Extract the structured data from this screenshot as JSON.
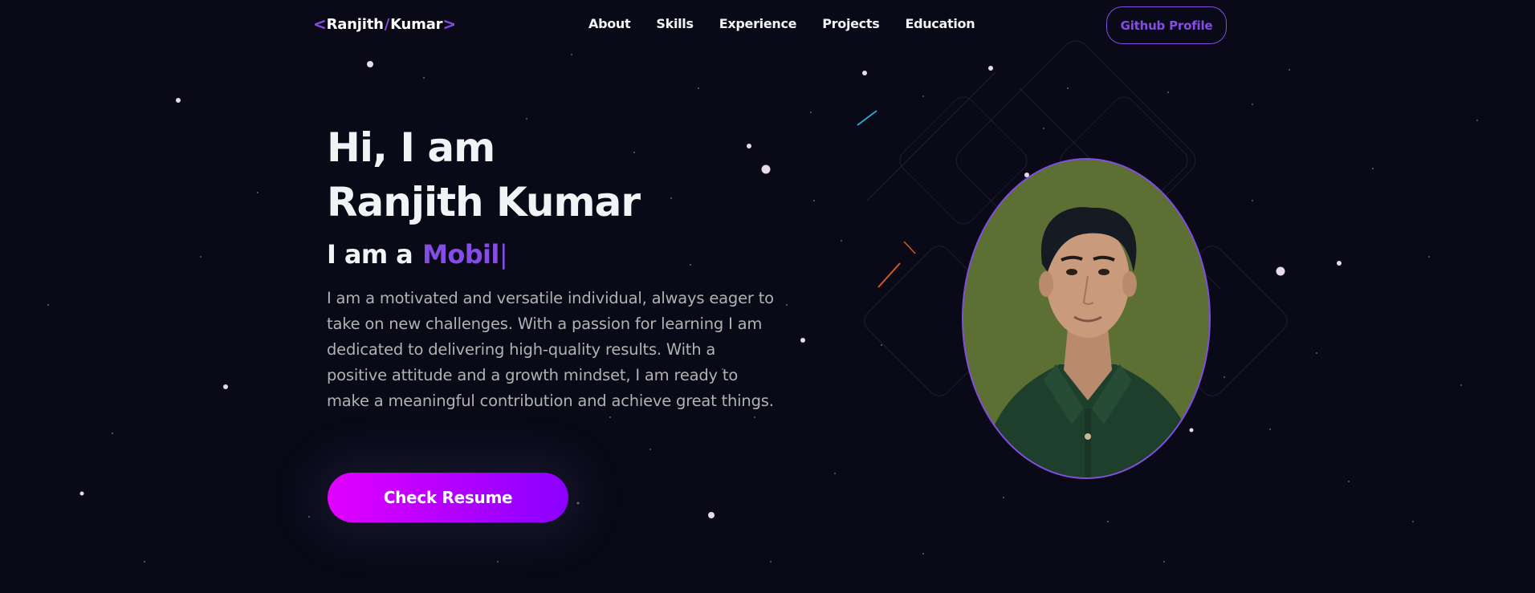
{
  "nav": {
    "logo": {
      "left_bracket": "<",
      "first": "Ranjith",
      "slash": "/",
      "last": "Kumar",
      "right_bracket": ">"
    },
    "links": [
      "About",
      "Skills",
      "Experience",
      "Projects",
      "Education"
    ],
    "github_label": "Github Profile"
  },
  "hero": {
    "title_line1": "Hi, I am",
    "title_line2": "Ranjith Kumar",
    "role_prefix": "I am a",
    "role_typed": "Mobil",
    "role_cursor": "|",
    "description": "I am a motivated and versatile individual, always eager to take on new challenges. With a passion for learning I am dedicated to delivering high-quality results. With a positive attitude and a growth mindset, I am ready to make a meaningful contribution and achieve great things.",
    "resume_label": "Check Resume"
  },
  "colors": {
    "background": "#090917",
    "accent": "#854ce6",
    "text_primary": "#f2f3f4",
    "text_secondary": "#b1b2b3",
    "button_gradient_start": "#e100ff",
    "button_gradient_end": "#8a00ff",
    "photo_background": "#5b7032"
  },
  "icons": {
    "logo_left": "chevron-left-icon",
    "logo_right": "chevron-right-icon"
  }
}
